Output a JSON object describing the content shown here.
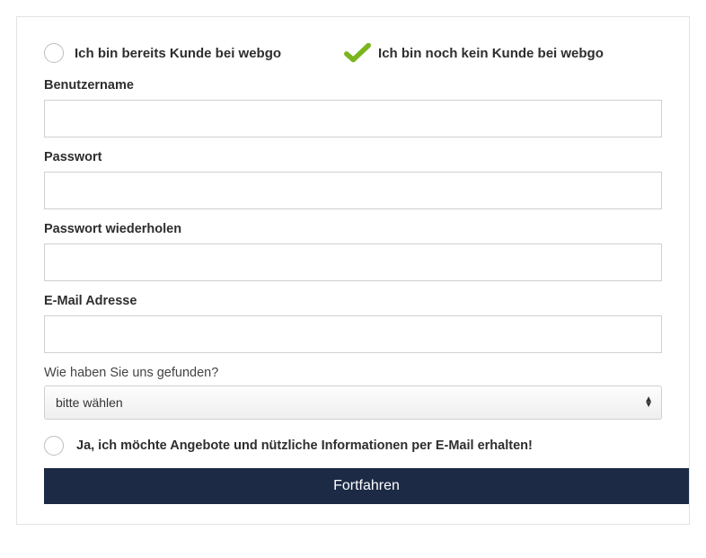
{
  "options": {
    "existing_customer_label": "Ich bin bereits Kunde bei webgo",
    "new_customer_label": "Ich bin noch kein Kunde bei webgo"
  },
  "fields": {
    "username": {
      "label": "Benutzername",
      "value": ""
    },
    "password": {
      "label": "Passwort",
      "value": ""
    },
    "password_repeat": {
      "label": "Passwort wiederholen",
      "value": ""
    },
    "email": {
      "label": "E-Mail Adresse",
      "value": ""
    }
  },
  "how_found": {
    "label": "Wie haben Sie uns gefunden?",
    "selected": "bitte wählen"
  },
  "consent": {
    "label": "Ja, ich möchte Angebote und nützliche Informationen per E-Mail erhalten!"
  },
  "submit": {
    "label": "Fortfahren"
  },
  "colors": {
    "accent_green": "#7ab51d",
    "button_bg": "#1c2a45"
  }
}
